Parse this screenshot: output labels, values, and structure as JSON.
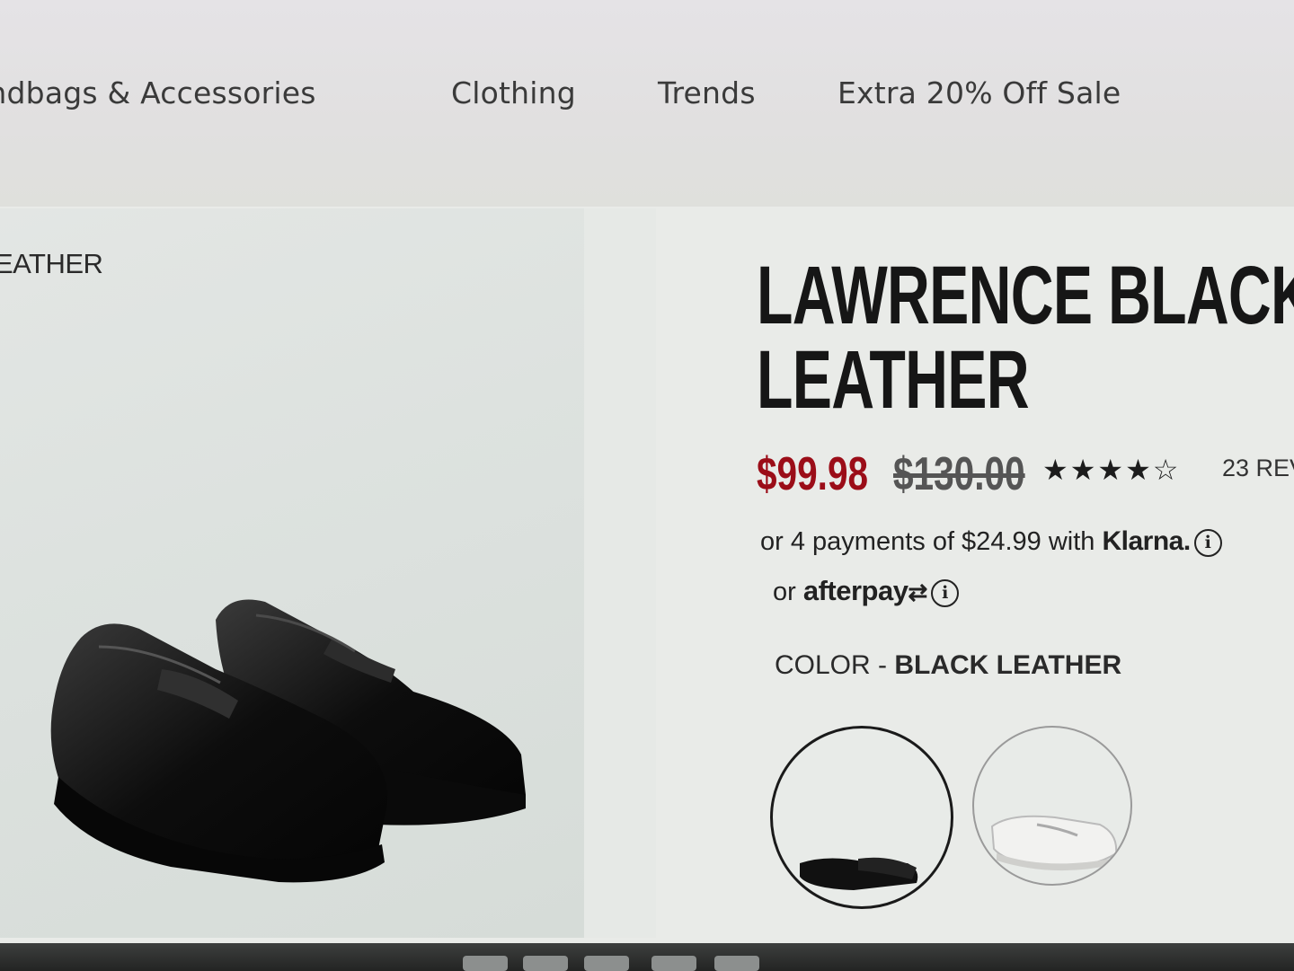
{
  "nav": {
    "items": [
      {
        "label": "andbags & Accessories"
      },
      {
        "label": "Clothing"
      },
      {
        "label": "Trends"
      },
      {
        "label": "Extra 20% Off Sale"
      }
    ]
  },
  "gallery": {
    "label": "EATHER"
  },
  "product": {
    "title_line1": "LAWRENCE BLACK",
    "title_line2": "LEATHER",
    "sale_price": "$99.98",
    "original_price": "$130.00",
    "rating": 4,
    "rating_max": 5,
    "review_text": "23 REV"
  },
  "payments": {
    "klarna_text": "or 4 payments of $24.99 with",
    "klarna_brand": "Klarna.",
    "afterpay_prefix": "or",
    "afterpay_brand": "afterpay",
    "info_glyph": "i"
  },
  "color": {
    "label": "COLOR - ",
    "value": "BLACK LEATHER",
    "swatches": [
      {
        "name": "black-leather",
        "selected": true
      },
      {
        "name": "white-leather",
        "selected": false
      }
    ]
  },
  "colors": {
    "sale_price": "#9b0d18",
    "background": "#e9ebe8"
  }
}
